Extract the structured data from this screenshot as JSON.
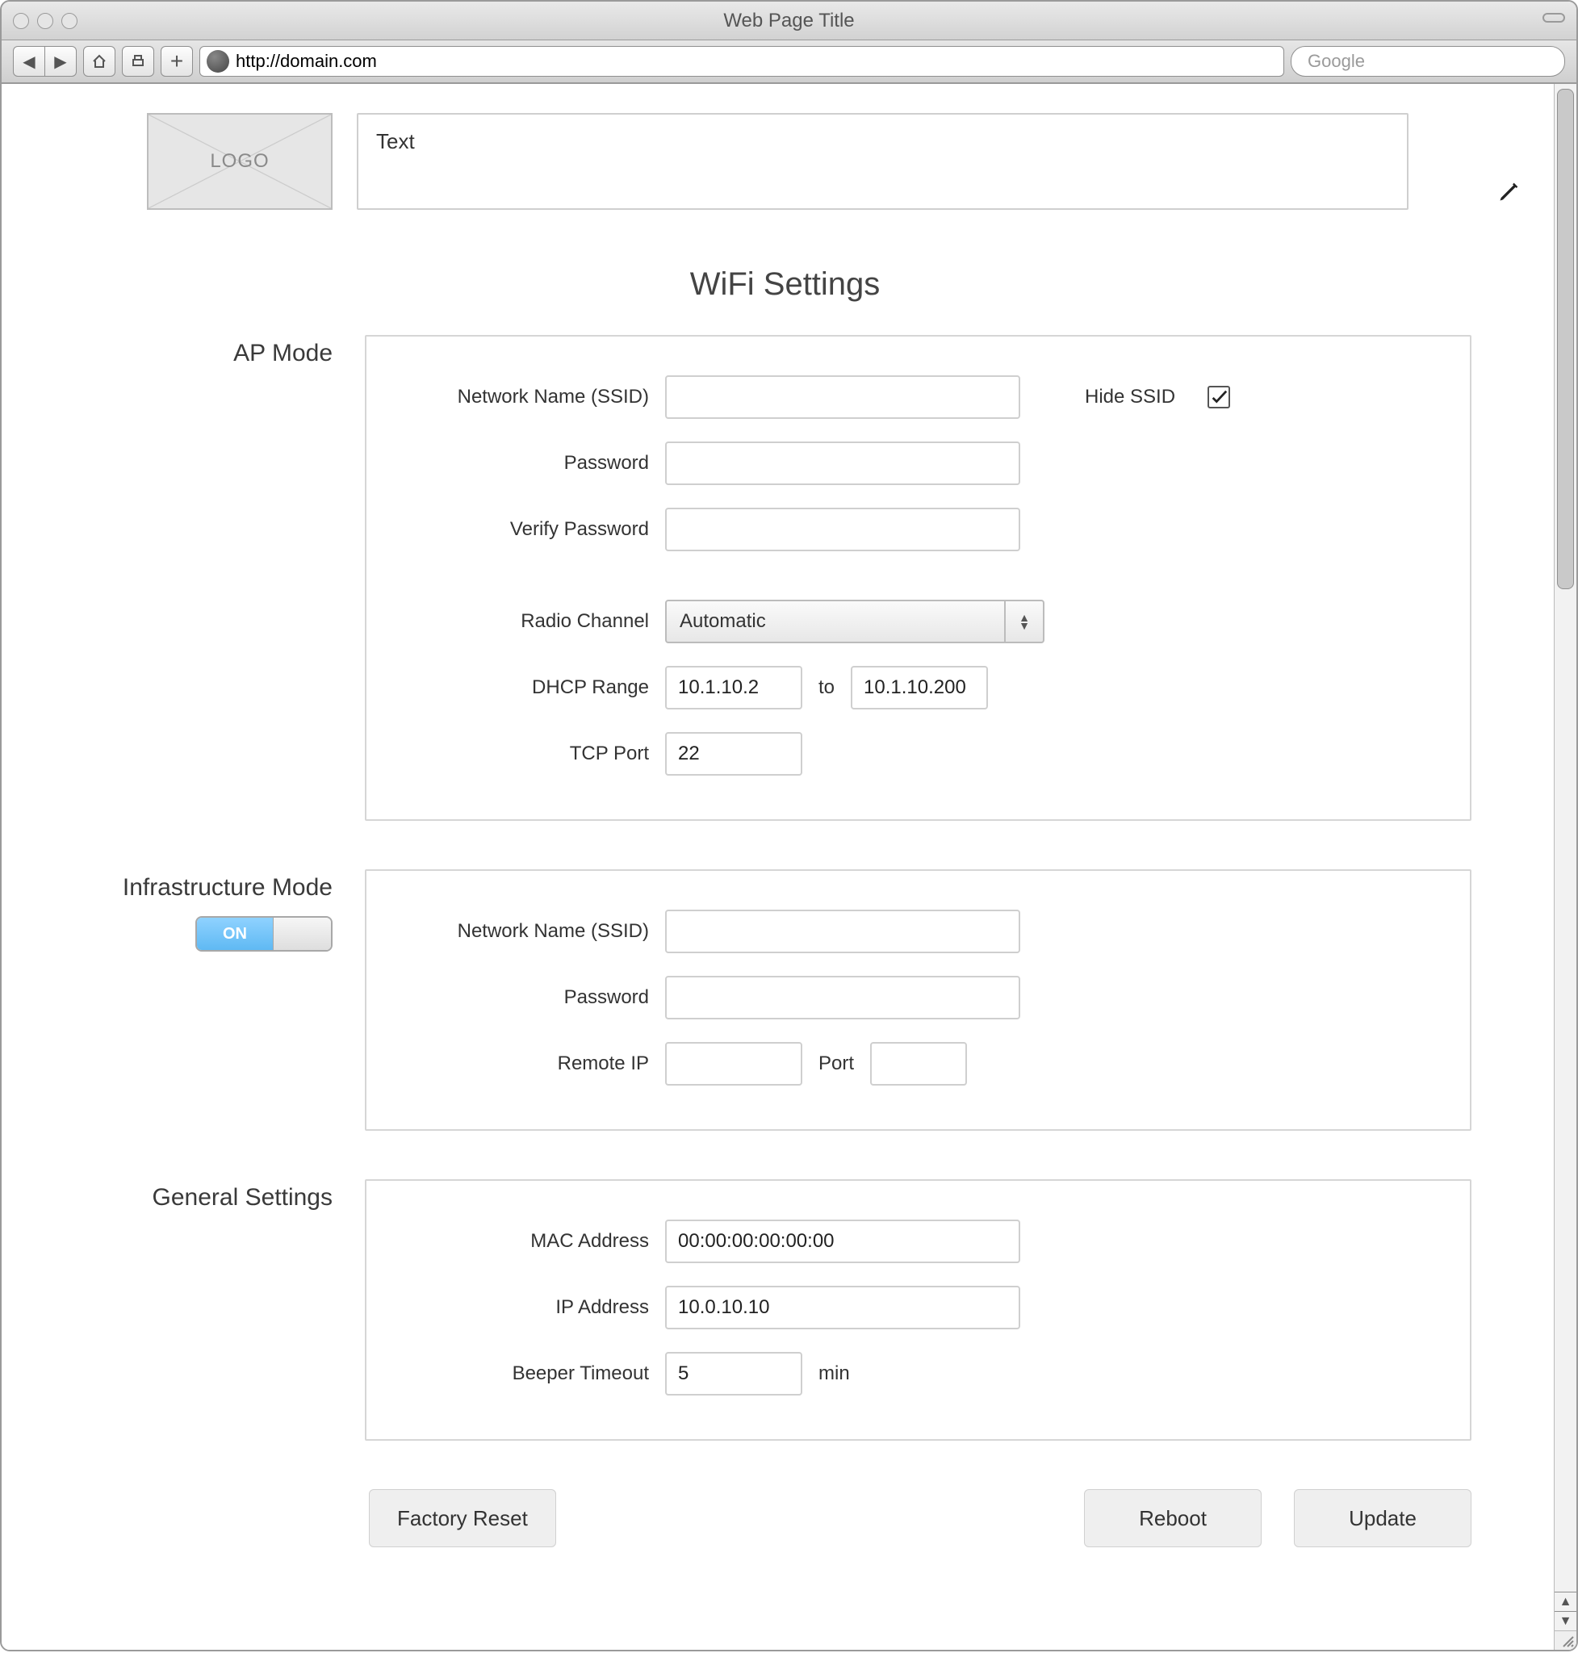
{
  "chrome": {
    "window_title": "Web Page Title",
    "url": "http://domain.com",
    "search_placeholder": "Google"
  },
  "header": {
    "logo_text": "LOGO",
    "banner_text": "Text"
  },
  "page_title": "WiFi Settings",
  "ap_mode": {
    "section_label": "AP Mode",
    "ssid_label": "Network Name (SSID)",
    "ssid_value": "",
    "hide_ssid_label": "Hide SSID",
    "hide_ssid_checked": true,
    "password_label": "Password",
    "password_value": "",
    "verify_label": "Verify Password",
    "verify_value": "",
    "radio_label": "Radio Channel",
    "radio_value": "Automatic",
    "dhcp_label": "DHCP Range",
    "dhcp_from": "10.1.10.2",
    "dhcp_to_word": "to",
    "dhcp_to": "10.1.10.200",
    "tcp_label": "TCP Port",
    "tcp_value": "22"
  },
  "infra_mode": {
    "section_label": "Infrastructure Mode",
    "toggle_state": "ON",
    "ssid_label": "Network Name (SSID)",
    "ssid_value": "",
    "password_label": "Password",
    "password_value": "",
    "remote_ip_label": "Remote IP",
    "remote_ip_value": "",
    "port_label": "Port",
    "port_value": ""
  },
  "general": {
    "section_label": "General Settings",
    "mac_label": "MAC Address",
    "mac_value": "00:00:00:00:00:00",
    "ip_label": "IP Address",
    "ip_value": "10.0.10.10",
    "beeper_label": "Beeper Timeout",
    "beeper_value": "5",
    "beeper_unit": "min"
  },
  "buttons": {
    "factory_reset": "Factory Reset",
    "reboot": "Reboot",
    "update": "Update"
  }
}
